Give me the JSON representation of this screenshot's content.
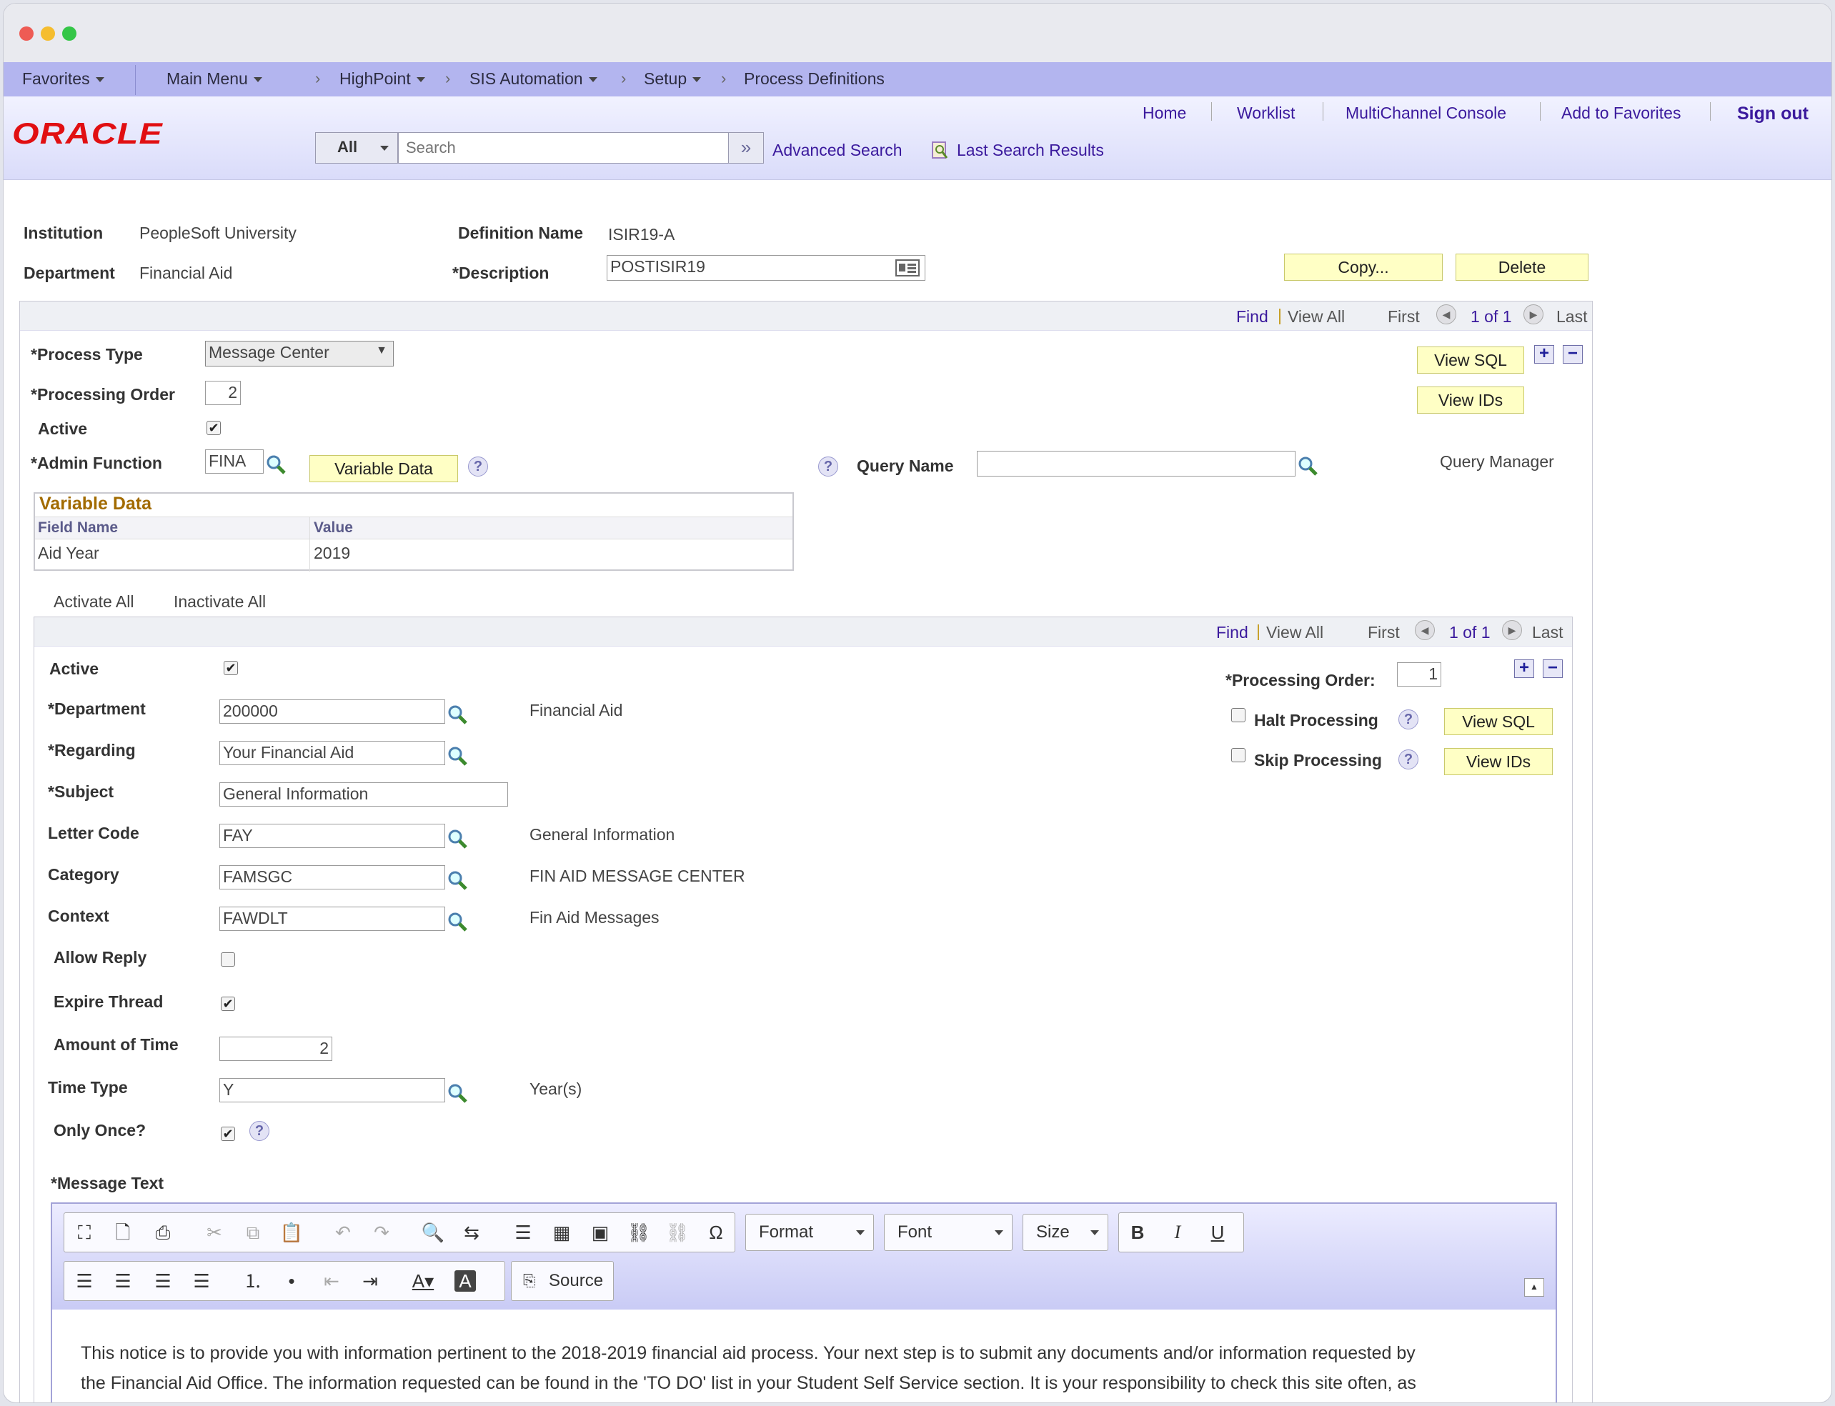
{
  "nav": {
    "favorites": "Favorites",
    "main_menu": "Main Menu",
    "crumbs": [
      "HighPoint",
      "SIS Automation",
      "Setup",
      "Process Definitions"
    ]
  },
  "header": {
    "logo": "ORACLE",
    "links": [
      "Home",
      "Worklist",
      "MultiChannel Console",
      "Add to Favorites"
    ],
    "sign_out": "Sign out",
    "search_scope": "All",
    "search_placeholder": "Search",
    "advanced_search": "Advanced Search",
    "last_search_results": "Last Search Results"
  },
  "definition": {
    "institution_label": "Institution",
    "institution": "PeopleSoft University",
    "department_label": "Department",
    "department": "Financial Aid",
    "def_name_label": "Definition Name",
    "def_name": "ISIR19-A",
    "description_label": "*Description",
    "description": "POSTISIR19",
    "copy_button": "Copy...",
    "delete_button": "Delete"
  },
  "outer_grid": {
    "find": "Find",
    "view_all": "View All",
    "first": "First",
    "count": "1 of 1",
    "last": "Last",
    "process_type_label": "*Process Type",
    "process_type": "Message Center",
    "processing_order_label": "*Processing Order",
    "processing_order": "2",
    "active_label": "Active",
    "active": true,
    "admin_function_label": "*Admin Function",
    "admin_function": "FINA",
    "variable_data_button": "Variable Data",
    "query_name_label": "Query Name",
    "query_name": "",
    "query_manager": "Query Manager",
    "view_sql": "View SQL",
    "view_ids": "View IDs",
    "variable_data": {
      "title": "Variable Data",
      "col_field": "Field Name",
      "col_value": "Value",
      "rows": [
        {
          "field": "Aid Year",
          "value": "2019"
        }
      ]
    }
  },
  "inner_grid": {
    "activate_all": "Activate All",
    "inactivate_all": "Inactivate All",
    "find": "Find",
    "view_all": "View All",
    "first": "First",
    "count": "1 of 1",
    "last": "Last",
    "active_label": "Active",
    "department_label": "*Department",
    "department": "200000",
    "department_desc": "Financial Aid",
    "regarding_label": "*Regarding",
    "regarding": "Your Financial Aid",
    "subject_label": "*Subject",
    "subject": "General Information",
    "letter_code_label": "Letter Code",
    "letter_code": "FAY",
    "letter_code_desc": "General Information",
    "category_label": "Category",
    "category": "FAMSGC",
    "category_desc": "FIN AID MESSAGE CENTER",
    "context_label": "Context",
    "context": "FAWDLT",
    "context_desc": "Fin Aid Messages",
    "allow_reply_label": "Allow Reply",
    "expire_thread_label": "Expire Thread",
    "amount_of_time_label": "Amount of Time",
    "amount_of_time": "2",
    "time_type_label": "Time Type",
    "time_type": "Y",
    "time_type_desc": "Year(s)",
    "only_once_label": "Only Once?",
    "processing_order_label": "*Processing Order:",
    "processing_order": "1",
    "halt_processing_label": "Halt Processing",
    "skip_processing_label": "Skip Processing",
    "view_sql": "View SQL",
    "view_ids": "View IDs",
    "message_text_label": "*Message Text"
  },
  "editor": {
    "format": "Format",
    "font": "Font",
    "size": "Size",
    "source": "Source",
    "body_line1": "This notice is to provide you with information pertinent to the 2018-2019 financial aid process. Your next step is to submit any documents and/or information requested by",
    "body_line2": "the Financial Aid Office. The information requested can be found in the 'TO DO' list in your Student Self Service section. It is your responsibility to check this site often, as"
  }
}
